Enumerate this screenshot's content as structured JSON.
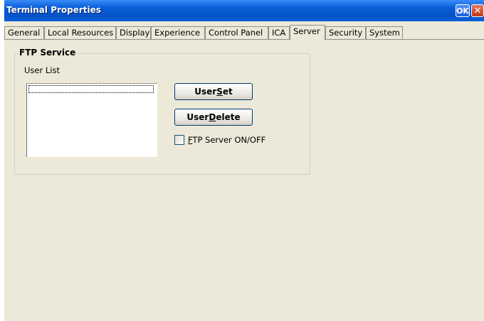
{
  "window": {
    "title": "Terminal Properties",
    "ok_label": "OK",
    "close_label": "✕"
  },
  "tabs": [
    {
      "label": "General"
    },
    {
      "label": "Local Resources"
    },
    {
      "label": "Display"
    },
    {
      "label": "Experience"
    },
    {
      "label": "Control Panel"
    },
    {
      "label": "ICA"
    },
    {
      "label": "Server"
    },
    {
      "label": "Security"
    },
    {
      "label": "System"
    }
  ],
  "active_tab": "Server",
  "ftp": {
    "group_title": "FTP Service",
    "user_list_label": "User List",
    "user_set": {
      "pre": "User ",
      "key": "S",
      "post": "et"
    },
    "user_delete": {
      "pre": "User ",
      "key": "D",
      "post": "elete"
    },
    "checkbox": {
      "key": "F",
      "post": "TP Server ON/OFF",
      "checked": false
    }
  },
  "colors": {
    "titlebar": "#0a5fd8",
    "dialog_bg": "#ece9d8"
  }
}
